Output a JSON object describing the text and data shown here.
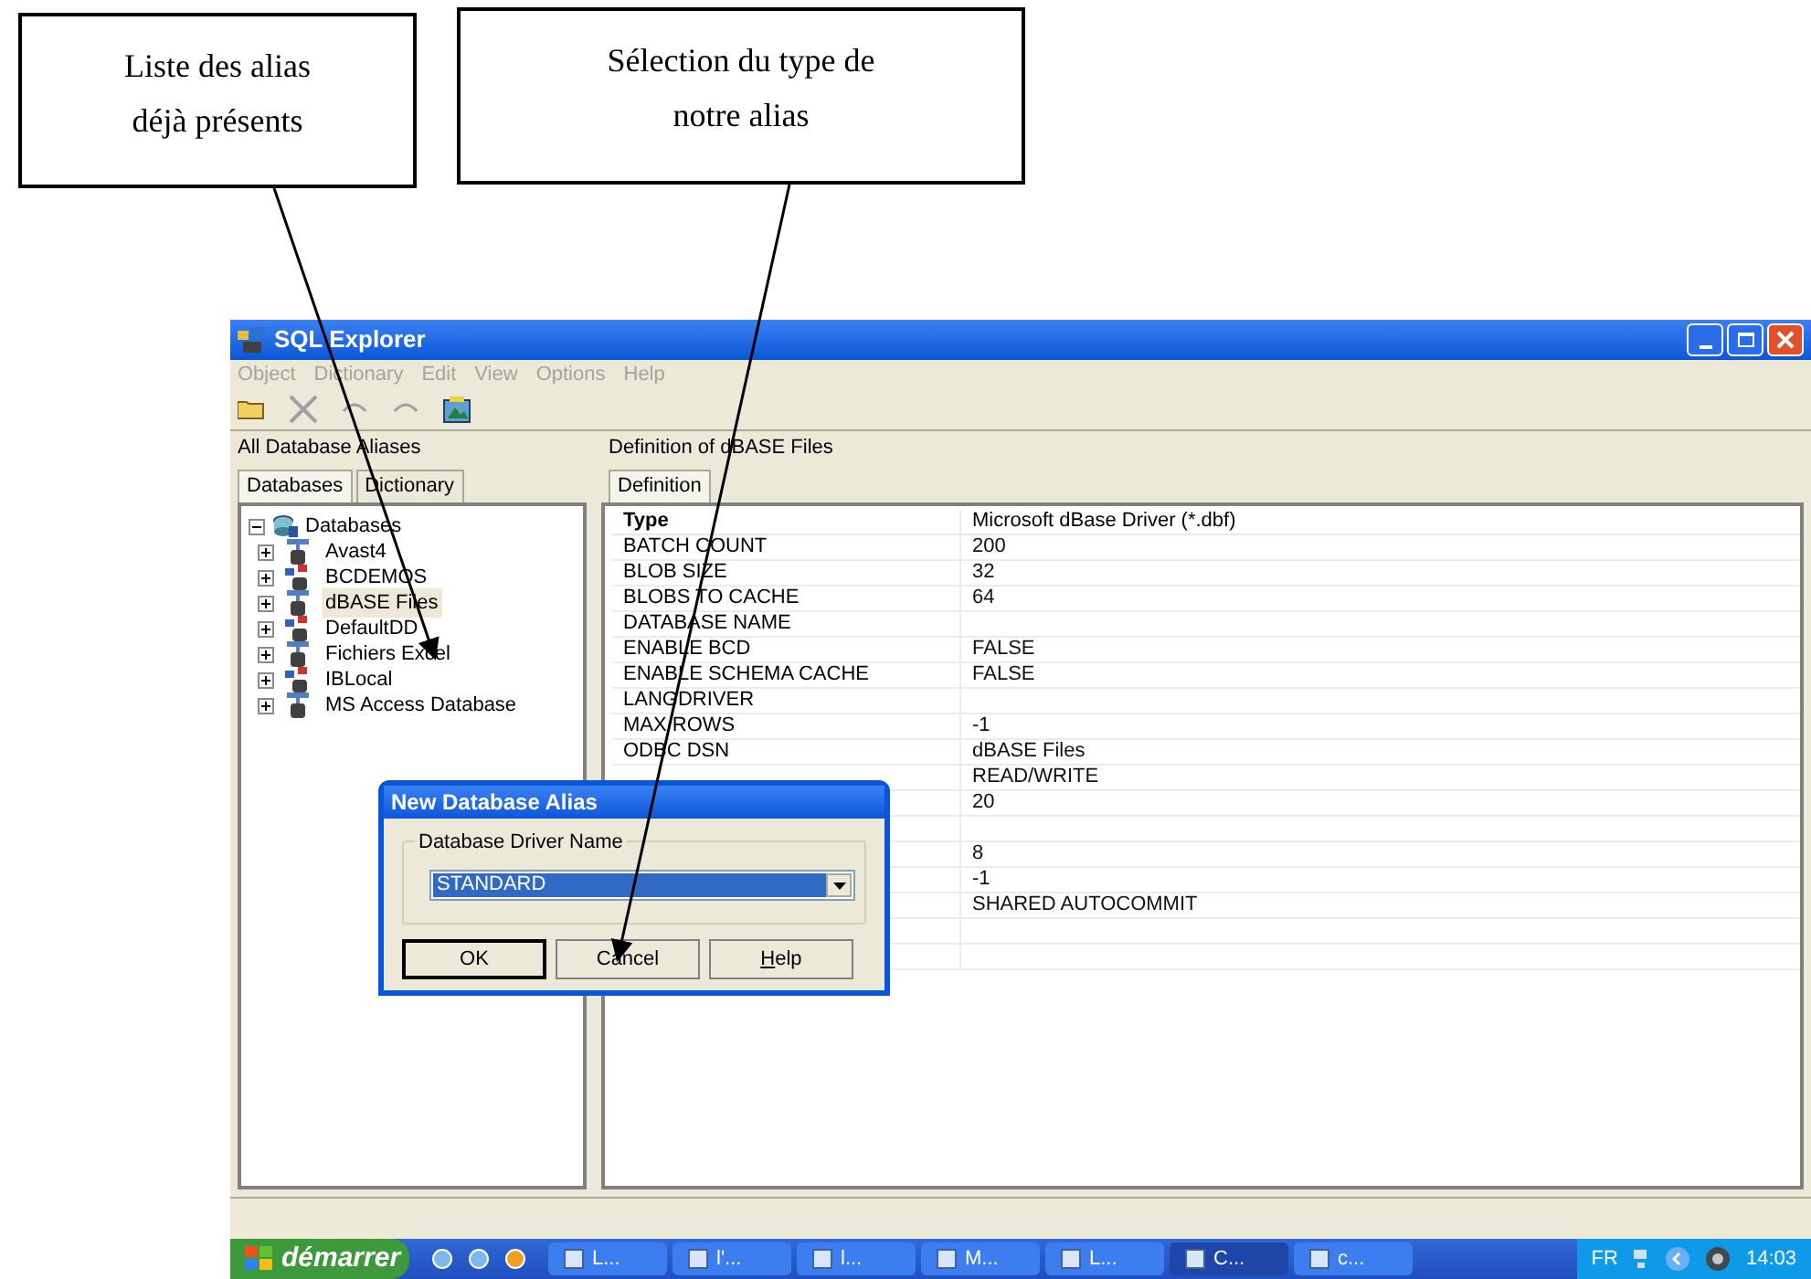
{
  "callouts": [
    {
      "text": "Liste des alias déjà présents"
    },
    {
      "text": "Sélection du type de notre alias"
    }
  ],
  "window": {
    "title": "SQL Explorer"
  },
  "menu": [
    {
      "label": "Object",
      "disabled": true
    },
    {
      "label": "Dictionary",
      "disabled": true
    },
    {
      "label": "Edit",
      "disabled": true
    },
    {
      "label": "View",
      "disabled": true
    },
    {
      "label": "Options",
      "disabled": true
    },
    {
      "label": "Help",
      "disabled": true
    }
  ],
  "left_header": "All Database Aliases",
  "right_header": "Definition of dBASE Files",
  "left_tabs": [
    {
      "label": "Databases",
      "selected": true
    },
    {
      "label": "Dictionary",
      "selected": false
    }
  ],
  "right_tabs": [
    {
      "label": "Definition",
      "selected": true
    }
  ],
  "tree": {
    "label": "Databases",
    "expanded": true,
    "children": [
      {
        "label": "Avast4",
        "kind": "odbc",
        "selected": false
      },
      {
        "label": "BCDEMOS",
        "kind": "native",
        "selected": false
      },
      {
        "label": "dBASE Files",
        "kind": "odbc",
        "selected": true
      },
      {
        "label": "DefaultDD",
        "kind": "native",
        "selected": false
      },
      {
        "label": "Fichiers Excel",
        "kind": "odbc",
        "selected": false
      },
      {
        "label": "IBLocal",
        "kind": "native",
        "selected": false
      },
      {
        "label": "MS Access Database",
        "kind": "odbc",
        "selected": false
      }
    ]
  },
  "grid": [
    {
      "kind": "heading",
      "name": "Type",
      "value": "Microsoft dBase Driver (*.dbf)"
    },
    {
      "kind": "property",
      "name": "BATCH COUNT",
      "value": "200"
    },
    {
      "kind": "property",
      "name": "BLOB SIZE",
      "value": "32"
    },
    {
      "kind": "property",
      "name": "BLOBS TO CACHE",
      "value": "64"
    },
    {
      "kind": "property",
      "name": "DATABASE NAME"
    },
    {
      "kind": "property",
      "name": "ENABLE BCD",
      "value": "FALSE"
    },
    {
      "kind": "property",
      "name": "ENABLE SCHEMA CACHE",
      "value": "FALSE"
    },
    {
      "kind": "property",
      "name": "LANGDRIVER"
    },
    {
      "kind": "property",
      "name": "MAX ROWS",
      "value": "-1"
    },
    {
      "kind": "property",
      "name": "ODBC DSN",
      "value": "dBASE Files"
    },
    {
      "kind": "property",
      "value": "READ/WRITE"
    },
    {
      "kind": "property",
      "value": "20"
    },
    {
      "kind": "property"
    },
    {
      "kind": "property",
      "value": "8"
    },
    {
      "kind": "property",
      "value": "-1"
    },
    {
      "kind": "property",
      "value": "SHARED AUTOCOMMIT"
    },
    {
      "kind": "property"
    },
    {
      "kind": "property"
    }
  ],
  "dialog": {
    "title": "New Database Alias",
    "group_label": "Database Driver Name",
    "driver": "STANDARD",
    "buttons": [
      {
        "label": "OK",
        "default": true
      },
      {
        "label": "Cancel",
        "default": false
      },
      {
        "label": "Help",
        "default": false,
        "mnemonic": true
      }
    ]
  },
  "taskbar": {
    "start": "démarrer",
    "tasks": [
      {
        "label": "L...",
        "selected": false
      },
      {
        "label": "l'...",
        "selected": false
      },
      {
        "label": "l...",
        "selected": false
      },
      {
        "label": "M...",
        "selected": false
      },
      {
        "label": "L...",
        "selected": false
      },
      {
        "label": "C...",
        "selected": true
      },
      {
        "label": "c...",
        "selected": false
      }
    ],
    "language": "FR",
    "clock": "14:03"
  }
}
